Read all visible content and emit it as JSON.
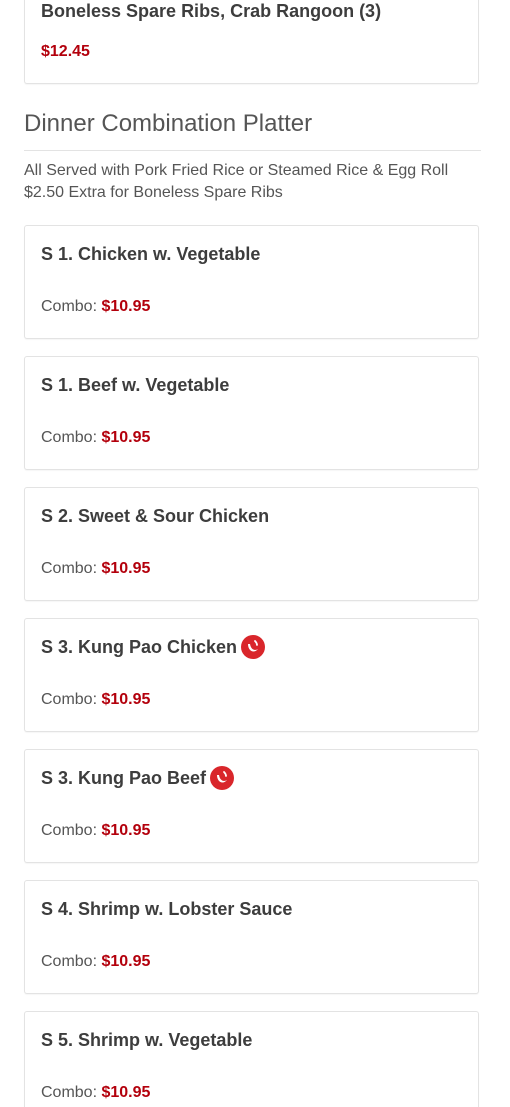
{
  "top_item": {
    "name": "Boneless Spare Ribs, Crab Rangoon (3)",
    "price": "$12.45"
  },
  "section": {
    "title": "Dinner Combination Platter",
    "description_lines": [
      "All Served with Pork Fried Rice or Steamed Rice & Egg Roll",
      "$2.50 Extra for Boneless Spare Ribs"
    ]
  },
  "price_label": "Combo:",
  "items": [
    {
      "name": "S 1. Chicken w. Vegetable",
      "price": "$10.95",
      "spicy": false
    },
    {
      "name": "S 1. Beef w. Vegetable",
      "price": "$10.95",
      "spicy": false
    },
    {
      "name": "S 2. Sweet & Sour Chicken",
      "price": "$10.95",
      "spicy": false
    },
    {
      "name": "S 3. Kung Pao Chicken",
      "price": "$10.95",
      "spicy": true
    },
    {
      "name": "S 3. Kung Pao Beef",
      "price": "$10.95",
      "spicy": true
    },
    {
      "name": "S 4. Shrimp w. Lobster Sauce",
      "price": "$10.95",
      "spicy": false
    },
    {
      "name": "S 5. Shrimp w. Vegetable",
      "price": "$10.95",
      "spicy": false
    }
  ],
  "colors": {
    "price": "#b3000c",
    "spicy_icon": "#d9262b",
    "border": "#e3e3e3"
  },
  "icons": {
    "spicy": "chili-pepper-icon"
  }
}
